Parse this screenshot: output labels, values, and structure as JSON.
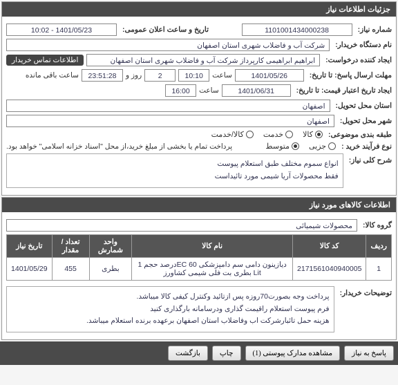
{
  "panels": {
    "details_title": "جزئیات اطلاعات نیاز",
    "items_title": "اطلاعات کالاهای مورد نیاز"
  },
  "labels": {
    "need_no": "شماره نیاز:",
    "announce_datetime": "تاریخ و ساعت اعلان عمومی:",
    "buyer_org": "نام دستگاه خریدار:",
    "request_creator": "ایجاد کننده درخواست:",
    "contact_info": "اطلاعات تماس خریدار",
    "deadline": "مهلت ارسال پاسخ: تا تاریخ:",
    "hour": "ساعت",
    "day": "روز و",
    "remaining": "ساعت باقی مانده",
    "validity": "ایجاد تاریخ اعتبار قیمت: تا تاریخ:",
    "delivery_city": "استان محل تحویل:",
    "delivery_city2": "شهر محل تحویل:",
    "subject_class": "طبقه بندی موضوعی:",
    "purchase_type": "نوع فرآیند خرید :",
    "general_title": "شرح کلی نیاز:",
    "goods_group": "گروه کالا:",
    "buyer_notes": "توضیحات خریدار:"
  },
  "values": {
    "need_no": "1101001434000238",
    "announce_datetime": "1401/05/23 - 10:02",
    "buyer_org": "شرکت آب و فاضلاب شهری استان اصفهان",
    "request_creator": "ابراهیم ابراهیمی کارپرداز شرکت آب و فاضلاب شهری استان اصفهان",
    "deadline_date": "1401/05/26",
    "deadline_time": "10:10",
    "days_left": "2",
    "time_left": "23:51:28",
    "validity_date": "1401/06/31",
    "validity_time": "16:00",
    "city1": "اصفهان",
    "city2": "اصفهان",
    "desc_line1": "انواع سموم مختلف طبق استعلام پیوست",
    "desc_line2": "فقط محصولات آریا شیمی مورد تائیداست",
    "goods_group": "محصولات شیمیائی",
    "note_line1": "پرداخت وجه بصورت70روزه پس ازتائید وکنترل کیفی کالا میباشد.",
    "note_line2": "فرم پیوست استعلام راقیمت گذاری ودرسامانه بارگذاری کنید",
    "note_line3": "هزینه حمل تائبارشرکت اب وفاضلاب استان اصفهان برعهده برنده استعلام میباشد.",
    "payment_note": "پرداخت تمام یا بخشی از مبلغ خرید،از محل \"اسناد خزانه اسلامی\" خواهد بود."
  },
  "radios": {
    "subject": [
      {
        "label": "کالا",
        "checked": true
      },
      {
        "label": "خدمت",
        "checked": false
      },
      {
        "label": "کالا/خدمت",
        "checked": false
      }
    ],
    "purchase": [
      {
        "label": "جزیی",
        "checked": false
      },
      {
        "label": "متوسط",
        "checked": true
      }
    ]
  },
  "table": {
    "headers": [
      "ردیف",
      "کد کالا",
      "نام کالا",
      "واحد شمارش",
      "تعداد / مقدار",
      "تاریخ نیاز"
    ],
    "rows": [
      {
        "idx": "1",
        "code": "2171561040940005",
        "name": "دیازینون دامی سم دامپزشکی EC 60درصد حجم 1 Lit بطری بت فلی شیمی کشاورز",
        "unit": "بطری",
        "qty": "455",
        "date": "1401/05/29"
      }
    ]
  },
  "buttons": {
    "reply": "پاسخ به نیاز",
    "attachments": "مشاهده مدارک پیوستی (1)",
    "print": "چاپ",
    "back": "بازگشت"
  }
}
